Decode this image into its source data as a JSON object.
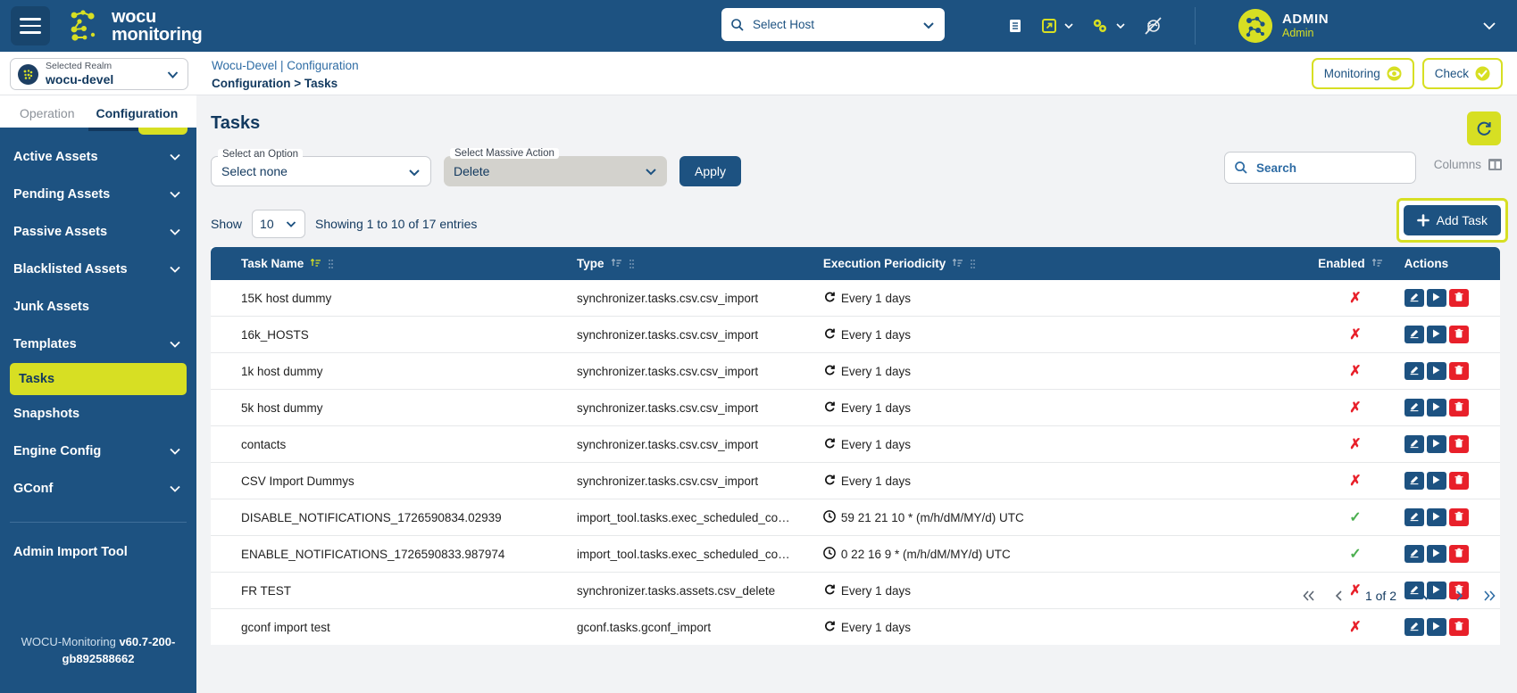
{
  "brand": {
    "line1": "wocu",
    "line2": "monitoring",
    "logo_icon": "wocu-logo-icon"
  },
  "topbar": {
    "menu_icon": "hamburger-icon",
    "host_search": {
      "placeholder": "Select Host",
      "icon": "search-icon",
      "chevron": "chevron-down-icon"
    },
    "icons": [
      {
        "name": "book-icon"
      },
      {
        "name": "external-link-icon"
      },
      {
        "name": "gears-icon"
      },
      {
        "name": "no-notifications-icon"
      }
    ],
    "user": {
      "name": "ADMIN",
      "role": "Admin",
      "avatar_icon": "avatar-icon",
      "chevron": "chevron-down-icon"
    }
  },
  "secondbar": {
    "realm": {
      "label": "Selected Realm",
      "value": "wocu-devel",
      "icon": "realm-icon",
      "chevron": "chevron-down-icon"
    },
    "breadcrumb_top": "Wocu-Devel | Configuration",
    "breadcrumb_bottom": "Configuration > Tasks",
    "monitoring_button": {
      "label": "Monitoring",
      "icon": "eye-icon"
    },
    "check_button": {
      "label": "Check",
      "icon": "check-circle-icon"
    }
  },
  "sidebar": {
    "tabs": [
      {
        "label": "Operation",
        "active": false
      },
      {
        "label": "Configuration",
        "active": true
      }
    ],
    "items": [
      {
        "label": "Active Assets",
        "expandable": true,
        "active": false
      },
      {
        "label": "Pending Assets",
        "expandable": true,
        "active": false
      },
      {
        "label": "Passive Assets",
        "expandable": true,
        "active": false
      },
      {
        "label": "Blacklisted Assets",
        "expandable": true,
        "active": false
      },
      {
        "label": "Junk Assets",
        "expandable": false,
        "active": false
      },
      {
        "label": "Templates",
        "expandable": true,
        "active": false
      },
      {
        "label": "Tasks",
        "expandable": false,
        "active": true
      },
      {
        "label": "Snapshots",
        "expandable": false,
        "active": false
      },
      {
        "label": "Engine Config",
        "expandable": true,
        "active": false
      },
      {
        "label": "GConf",
        "expandable": true,
        "active": false
      }
    ],
    "footer_item": "Admin Import Tool",
    "version_prefix": "WOCU-Monitoring ",
    "version": "v60.7-200-gb892588662"
  },
  "main": {
    "title": "Tasks",
    "refresh_icon": "refresh-icon",
    "select_option": {
      "label": "Select an Option",
      "value": "Select none"
    },
    "massive_action": {
      "label": "Select Massive Action",
      "value": "Delete"
    },
    "apply_label": "Apply",
    "show_label": "Show",
    "page_length": "10",
    "showing_info": "Showing 1 to 10 of 17 entries",
    "search": {
      "placeholder": "Search",
      "icon": "search-icon"
    },
    "columns_label": "Columns",
    "columns_icon": "columns-icon",
    "add_task_label": "Add Task",
    "add_task_icon": "plus-icon",
    "columns": [
      {
        "label": "Task Name",
        "sort": "active"
      },
      {
        "label": "Type",
        "sort": "inactive"
      },
      {
        "label": "Execution Periodicity",
        "sort": "inactive"
      },
      {
        "label": "Enabled",
        "sort": "inactive"
      },
      {
        "label": "Actions",
        "sort": "none"
      }
    ],
    "rows": [
      {
        "name": "15K host dummy",
        "type": "synchronizer.tasks.csv.csv_import",
        "period": "Every 1 days",
        "period_icon": "refresh-icon",
        "enabled": false
      },
      {
        "name": "16k_HOSTS",
        "type": "synchronizer.tasks.csv.csv_import",
        "period": "Every 1 days",
        "period_icon": "refresh-icon",
        "enabled": false
      },
      {
        "name": "1k host dummy",
        "type": "synchronizer.tasks.csv.csv_import",
        "period": "Every 1 days",
        "period_icon": "refresh-icon",
        "enabled": false
      },
      {
        "name": "5k host dummy",
        "type": "synchronizer.tasks.csv.csv_import",
        "period": "Every 1 days",
        "period_icon": "refresh-icon",
        "enabled": false
      },
      {
        "name": "contacts",
        "type": "synchronizer.tasks.csv.csv_import",
        "period": "Every 1 days",
        "period_icon": "refresh-icon",
        "enabled": false
      },
      {
        "name": "CSV Import Dummys",
        "type": "synchronizer.tasks.csv.csv_import",
        "period": "Every 1 days",
        "period_icon": "refresh-icon",
        "enabled": false
      },
      {
        "name": "DISABLE_NOTIFICATIONS_1726590834.02939",
        "type": "import_tool.tasks.exec_scheduled_co…",
        "period": "59 21 21 10 * (m/h/dM/MY/d) UTC",
        "period_icon": "clock-icon",
        "enabled": true
      },
      {
        "name": "ENABLE_NOTIFICATIONS_1726590833.987974",
        "type": "import_tool.tasks.exec_scheduled_co…",
        "period": "0 22 16 9 * (m/h/dM/MY/d) UTC",
        "period_icon": "clock-icon",
        "enabled": true
      },
      {
        "name": "FR TEST",
        "type": "synchronizer.tasks.assets.csv_delete",
        "period": "Every 1 days",
        "period_icon": "refresh-icon",
        "enabled": false
      },
      {
        "name": "gconf import test",
        "type": "gconf.tasks.gconf_import",
        "period": "Every 1 days",
        "period_icon": "refresh-icon",
        "enabled": false
      }
    ],
    "row_actions": [
      {
        "name": "edit-task-button",
        "icon": "pencil-icon"
      },
      {
        "name": "run-task-button",
        "icon": "play-icon"
      },
      {
        "name": "delete-task-button",
        "icon": "trash-icon"
      }
    ],
    "pagination": {
      "first": "«",
      "prev": "‹",
      "current": "1 of 2",
      "next": "›",
      "last": "»"
    }
  },
  "colors": {
    "brand_blue": "#1d5281",
    "accent_yellow": "#d7df23",
    "danger_red": "#e8202a",
    "success_green": "#4caf50",
    "page_bg": "#f2f3f5"
  }
}
